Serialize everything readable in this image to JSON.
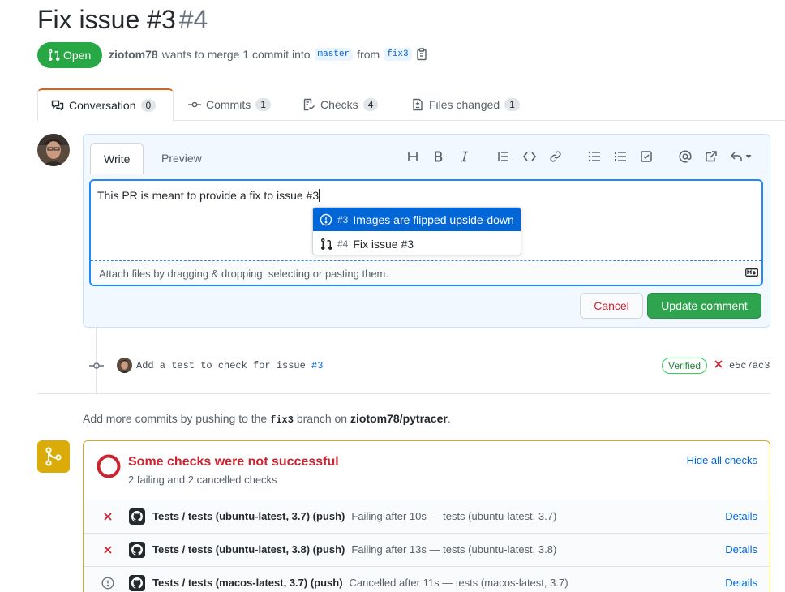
{
  "pr": {
    "title": "Fix issue #3",
    "number": "#4",
    "state": "Open",
    "author": "ziotom78",
    "merge_text": "wants to merge 1 commit into",
    "base_branch": "master",
    "from_text": "from",
    "head_branch": "fix3"
  },
  "tabs": [
    {
      "label": "Conversation",
      "count": "0"
    },
    {
      "label": "Commits",
      "count": "1"
    },
    {
      "label": "Checks",
      "count": "4"
    },
    {
      "label": "Files changed",
      "count": "1"
    }
  ],
  "editor": {
    "tab_write": "Write",
    "tab_preview": "Preview",
    "text": "This PR is meant to provide a fix to issue #3",
    "attach_note": "Attach files by dragging & dropping, selecting or pasting them.",
    "cancel_label": "Cancel",
    "update_label": "Update comment"
  },
  "suggestions": [
    {
      "number": "#3",
      "title": "Images are flipped upside-down",
      "kind": "issue"
    },
    {
      "number": "#4",
      "title": "Fix issue #3",
      "kind": "pull-request"
    }
  ],
  "commit": {
    "message": "Add a test to check for issue",
    "ref": "#3",
    "verified": "Verified",
    "sha": "e5c7ac3"
  },
  "push_note": {
    "before": "Add more commits by pushing to the",
    "branch": "fix3",
    "middle": "branch on",
    "repo": "ziotom78/pytracer",
    "after": "."
  },
  "checks": {
    "title": "Some checks were not successful",
    "subtitle": "2 failing and 2 cancelled checks",
    "hide_label": "Hide all checks",
    "details_label": "Details",
    "rows": [
      {
        "status": "failed",
        "name": "Tests / tests (ubuntu-latest, 3.7) (push)",
        "desc": "Failing after 10s — tests (ubuntu-latest, 3.7)"
      },
      {
        "status": "failed",
        "name": "Tests / tests (ubuntu-latest, 3.8) (push)",
        "desc": "Failing after 13s — tests (ubuntu-latest, 3.8)"
      },
      {
        "status": "cancelled",
        "name": "Tests / tests (macos-latest, 3.7) (push)",
        "desc": "Cancelled after 11s — tests (macos-latest, 3.7)"
      }
    ]
  },
  "colors": {
    "green": "#28a745",
    "blue": "#0366d6",
    "red": "#cb2431",
    "yellow": "#dbab09"
  },
  "icons": [
    "git-pull-request-icon",
    "clipboard-icon",
    "comment-discussion-icon",
    "git-commit-icon",
    "checklist-icon",
    "file-diff-icon",
    "heading-icon",
    "bold-icon",
    "italic-icon",
    "quote-icon",
    "code-icon",
    "link-icon",
    "unordered-list-icon",
    "ordered-list-icon",
    "task-list-icon",
    "mention-icon",
    "cross-reference-icon",
    "reply-icon",
    "issue-opened-icon",
    "markdown-icon",
    "x-icon",
    "git-branch-icon",
    "stop-icon",
    "github-mark-icon"
  ]
}
